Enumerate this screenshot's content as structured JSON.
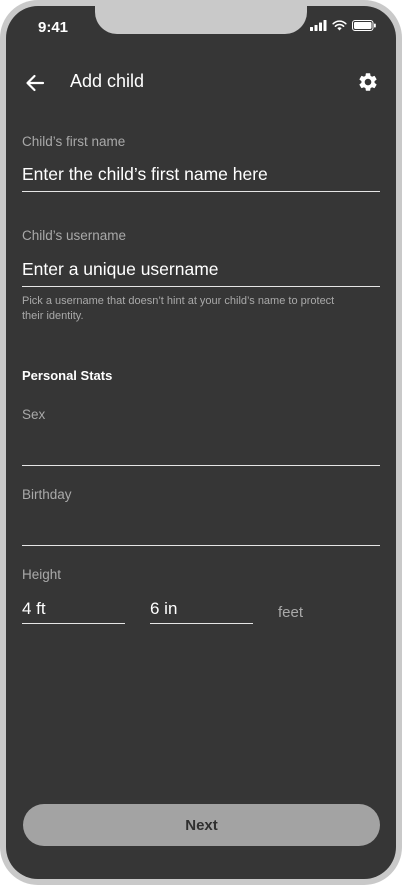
{
  "status_bar": {
    "time": "9:41"
  },
  "app_bar": {
    "title": "Add child"
  },
  "form": {
    "first_name": {
      "label": "Child’s first name",
      "placeholder": "Enter the child’s first name here",
      "value": ""
    },
    "username": {
      "label": "Child’s username",
      "placeholder": "Enter a unique username",
      "value": "",
      "helper": "Pick a username that doesn’t hint at your child’s name to protect their identity."
    },
    "personal_stats": {
      "heading": "Personal Stats",
      "sex": {
        "label": "Sex",
        "value": ""
      },
      "birthday": {
        "label": "Birthday",
        "value": ""
      },
      "height": {
        "label": "Height",
        "feet": "4 ft",
        "inches": "6 in",
        "unit": "feet"
      }
    }
  },
  "actions": {
    "next": "Next"
  },
  "icons": {
    "back": "arrow-left-icon",
    "settings": "gear-icon",
    "signal": "cellular-signal-icon",
    "wifi": "wifi-icon",
    "battery": "battery-icon"
  },
  "colors": {
    "background": "#363636",
    "text": "#ffffff",
    "muted": "#a9a9a9",
    "button": "#a3a3a3"
  }
}
